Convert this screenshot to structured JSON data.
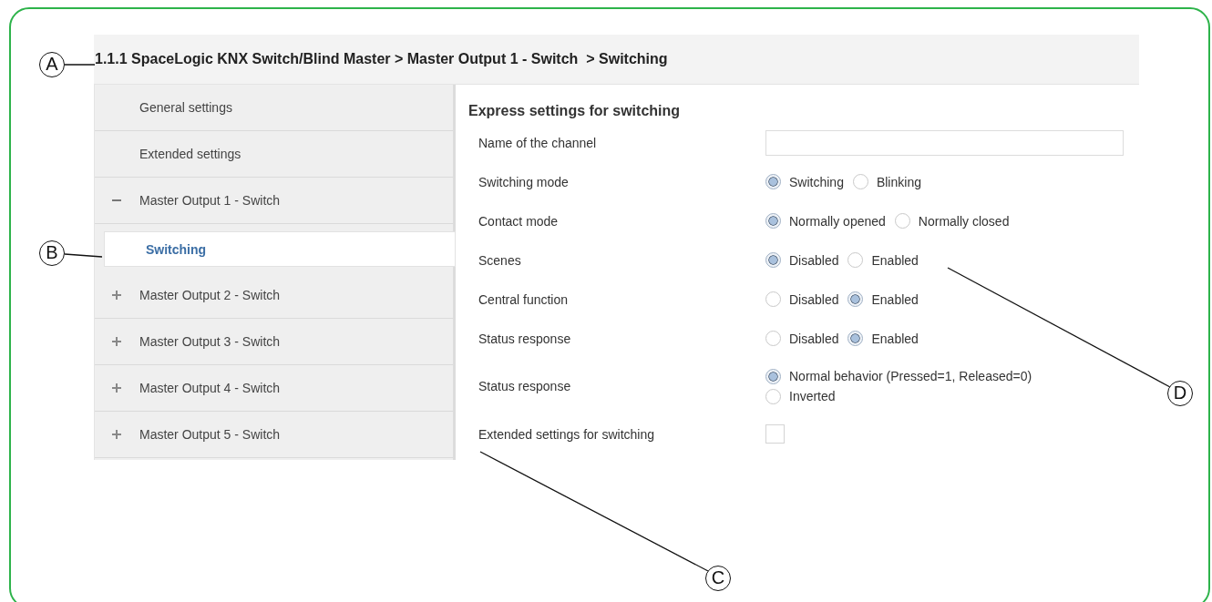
{
  "breadcrumb": "1.1.1 SpaceLogic KNX Switch/Blind Master > Master Output 1 - Switch  > Switching",
  "sidebar": {
    "items": [
      {
        "label": "General settings",
        "selected": false
      },
      {
        "label": "Extended settings",
        "selected": false
      },
      {
        "label": "Master Output 1 - Switch",
        "selected": false,
        "expanded": true,
        "children": [
          {
            "label": "Switching",
            "selected": true
          }
        ]
      },
      {
        "label": "Master Output 2 - Switch",
        "selected": false,
        "expanded": false
      },
      {
        "label": "Master Output 3 - Switch",
        "selected": false,
        "expanded": false
      },
      {
        "label": "Master Output 4 - Switch",
        "selected": false,
        "expanded": false
      },
      {
        "label": "Master Output 5 - Switch",
        "selected": false,
        "expanded": false
      }
    ]
  },
  "section_title": "Express settings for switching",
  "settings": [
    {
      "label": "Name of the channel",
      "kind": "text"
    },
    {
      "label": "Switching mode",
      "kind": "radio",
      "options": [
        {
          "label": "Switching",
          "selected": true
        },
        {
          "label": "Blinking",
          "selected": false
        }
      ]
    },
    {
      "label": "Contact mode",
      "kind": "radio",
      "options": [
        {
          "label": "Normally opened",
          "selected": true
        },
        {
          "label": "Normally closed",
          "selected": false
        }
      ]
    },
    {
      "label": "Scenes",
      "kind": "radio",
      "options": [
        {
          "label": "Disabled",
          "selected": true
        },
        {
          "label": "Enabled",
          "selected": false
        }
      ]
    },
    {
      "label": "Central function",
      "kind": "radio",
      "options": [
        {
          "label": "Disabled",
          "selected": false
        },
        {
          "label": "Enabled",
          "selected": true
        }
      ]
    },
    {
      "label": "Status response",
      "kind": "radio",
      "options": [
        {
          "label": "Disabled",
          "selected": false
        },
        {
          "label": "Enabled",
          "selected": true
        }
      ]
    },
    {
      "label": "Status response",
      "kind": "radio-stacked",
      "options": [
        {
          "label": "Normal behavior (Pressed=1, Released=0)",
          "selected": true
        },
        {
          "label": "Inverted",
          "selected": false
        }
      ]
    },
    {
      "label": "Extended settings for switching",
      "kind": "checkbox",
      "checked": false
    }
  ],
  "callouts": [
    {
      "label": "A"
    },
    {
      "label": "B"
    },
    {
      "label": "C"
    },
    {
      "label": "D"
    }
  ]
}
